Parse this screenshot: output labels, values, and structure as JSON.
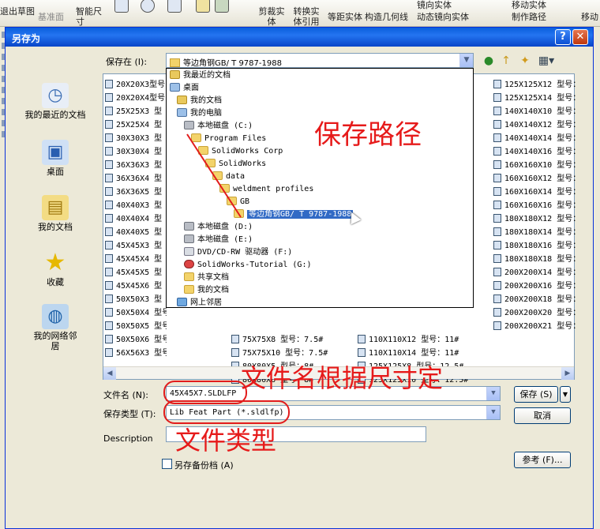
{
  "app_toolbar": {
    "items": [
      "退出草图",
      "基准面",
      "智能尺寸",
      "剪裁实体",
      "转换实体引用",
      "等距实体",
      "构造几何线",
      "镜向实体",
      "动态镜向实体",
      "移动实体",
      "制作路径",
      "移动"
    ]
  },
  "dialog": {
    "title": "另存为",
    "help": "?",
    "close": "✕",
    "save_in_label": "保存在 (I):",
    "save_in_value": "等边角钢GB/ T 9787-1988",
    "places": [
      {
        "label": "我的最近的文档",
        "icon": "recent-docs-icon"
      },
      {
        "label": "桌面",
        "icon": "desktop-icon"
      },
      {
        "label": "我的文档",
        "icon": "my-documents-icon"
      },
      {
        "label": "收藏",
        "icon": "favorites-icon"
      },
      {
        "label": "我的网络邻居",
        "icon": "network-icon"
      }
    ],
    "files_col1": [
      "20X20X3型号",
      "20X20X4型号",
      "25X25X3 型",
      "25X25X4 型",
      "30X30X3 型",
      "30X30X4 型",
      "36X36X3 型",
      "36X36X4 型",
      "36X36X5 型",
      "40X40X3 型",
      "40X40X4 型",
      "40X40X5 型",
      "45X45X3 型",
      "45X45X4 型",
      "45X45X5 型",
      "45X45X6 型",
      "50X50X3 型",
      "50X50X4 型号：5#",
      "50X50X5 型号：5#",
      "50X50X6 型号：5#",
      "56X56X3 型号：5.6#"
    ],
    "files_col2": [
      "75X75X8 型号：7.5#",
      "75X75X10 型号：7.5#",
      "80X80X5 型号：8#",
      "80X80X6 型号：8#"
    ],
    "files_col3": [
      "110X110X12 型号：11#",
      "110X110X14 型号：11#",
      "125X125X8 型号：12.5#",
      "125X125X10 型号：12.5#"
    ],
    "files_col4": [
      "125X125X12 型号：",
      "125X125X14 型号：",
      "140X140X10 型号：",
      "140X140X12 型号：",
      "140X140X14 型号：",
      "140X140X16 型号：",
      "160X160X10 型号：",
      "160X160X12 型号：",
      "160X160X14 型号：",
      "160X160X16 型号：",
      "180X180X12 型号：",
      "180X180X14 型号：",
      "180X180X16 型号：",
      "180X180X18 型号：",
      "200X200X14 型号：",
      "200X200X16 型号：",
      "200X200X18 型号：",
      "200X200X20 型号：",
      "200X200X21 型号："
    ],
    "dropdown": [
      {
        "label": "我最近的文档",
        "icon": "doc",
        "indent": 0
      },
      {
        "label": "桌面",
        "icon": "pc",
        "indent": 0
      },
      {
        "label": "我的文档",
        "icon": "doc",
        "indent": 1
      },
      {
        "label": "我的电脑",
        "icon": "pc",
        "indent": 1
      },
      {
        "label": "本地磁盘 (C:)",
        "icon": "drive",
        "indent": 2
      },
      {
        "label": "Program Files",
        "icon": "folder",
        "indent": 3
      },
      {
        "label": "SolidWorks Corp",
        "icon": "folder",
        "indent": 4
      },
      {
        "label": "SolidWorks",
        "icon": "folder",
        "indent": 5
      },
      {
        "label": "data",
        "icon": "folder",
        "indent": 6
      },
      {
        "label": "weldment profiles",
        "icon": "folder",
        "indent": 7
      },
      {
        "label": "GB",
        "icon": "folder",
        "indent": 8
      },
      {
        "label": "等边角钢GB/ T 9787-1988",
        "icon": "folder",
        "indent": 9,
        "selected": true
      },
      {
        "label": "本地磁盘 (D:)",
        "icon": "drive",
        "indent": 2
      },
      {
        "label": "本地磁盘 (E:)",
        "icon": "drive",
        "indent": 2
      },
      {
        "label": "DVD/CD-RW 驱动器 (F:)",
        "icon": "cd",
        "indent": 2
      },
      {
        "label": "SolidWorks-Tutorial (G:)",
        "icon": "red",
        "indent": 2
      },
      {
        "label": "共享文档",
        "icon": "folder",
        "indent": 2
      },
      {
        "label": "我的文档",
        "icon": "folder",
        "indent": 2
      },
      {
        "label": "网上邻居",
        "icon": "net",
        "indent": 1
      }
    ],
    "filename_label": "文件名 (N):",
    "filename_value": "45X45X7.SLDLFP",
    "filetype_label": "保存类型 (T):",
    "filetype_value": "Lib Feat Part (*.sldlfp)",
    "description_label": "Description",
    "save_copy_label": "另存备份档 (A)",
    "save_button": "保存 (S)",
    "cancel_button": "取消",
    "reference_button": "参考 (F)..."
  },
  "annotations": {
    "save_path": "保存路径",
    "filename_note": "文件名根据尺寸定",
    "filetype_note": "文件类型"
  },
  "colors": {
    "annotation": "#e61a1a",
    "titlebar": "#0a5fdc",
    "selection": "#316ac5"
  }
}
